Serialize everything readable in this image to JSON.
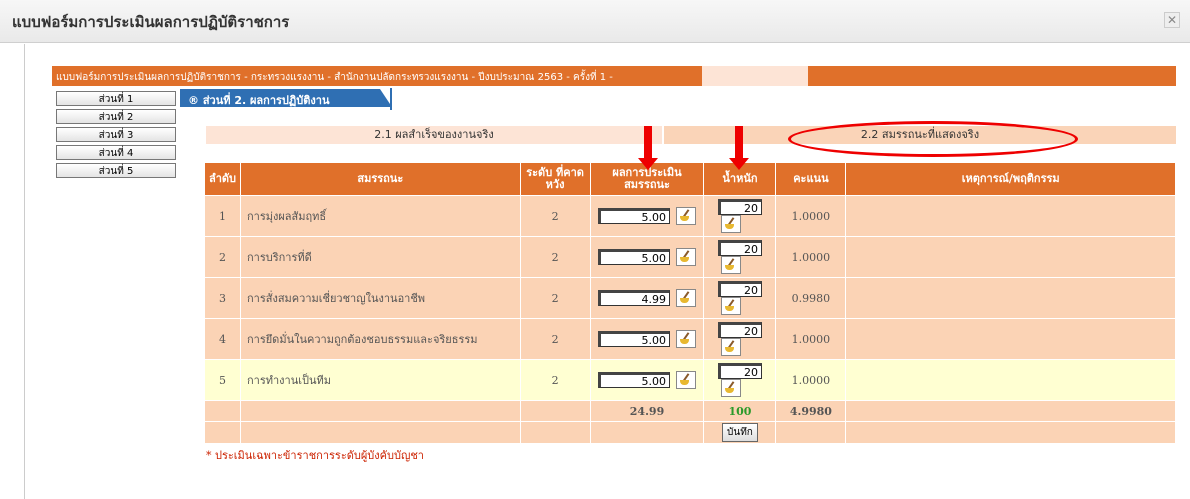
{
  "modal": {
    "title": "แบบฟอร์มการประเมินผลการปฏิบัติราชการ",
    "close_icon": "close-icon"
  },
  "header_bar": {
    "text": "แบบฟอร์มการประเมินผลการปฏิบัติราชการ - กระทรวงแรงงาน - สำนักงานปลัดกระทรวงแรงงาน - ปีงบประมาณ 2563 - ครั้งที่ 1 -"
  },
  "sidebar": {
    "items": [
      "ส่วนที่ 1",
      "ส่วนที่ 2",
      "ส่วนที่ 3",
      "ส่วนที่ 4",
      "ส่วนที่ 5"
    ]
  },
  "section_tab": {
    "label": "® ส่วนที่ 2. ผลการปฏิบัติงาน"
  },
  "subtabs": {
    "a": "2.1 ผลสำเร็จของงานจริง",
    "b": "2.2 สมรรถนะที่แสดงจริง"
  },
  "table": {
    "headers": {
      "no": "ลำดับ",
      "competency": "สมรรถนะ",
      "expected": "ระดับ ที่คาดหวัง",
      "score": "ผลการประเมิน สมรรถนะ",
      "weight": "น้ำหนัก",
      "points": "คะแนน",
      "event": "เหตุการณ์/พฤติกรรม"
    },
    "rows": [
      {
        "no": "1",
        "name": "การมุ่งผลสัมฤทธิ์",
        "expected": "2",
        "score": "5.00",
        "weight": "20",
        "points": "1.0000"
      },
      {
        "no": "2",
        "name": "การบริการที่ดี",
        "expected": "2",
        "score": "5.00",
        "weight": "20",
        "points": "1.0000"
      },
      {
        "no": "3",
        "name": "การสั่งสมความเชี่ยวชาญในงานอาชีพ",
        "expected": "2",
        "score": "4.99",
        "weight": "20",
        "points": "0.9980"
      },
      {
        "no": "4",
        "name": "การยึดมั่นในความถูกต้องชอบธรรมและจริยธรรม",
        "expected": "2",
        "score": "5.00",
        "weight": "20",
        "points": "1.0000"
      },
      {
        "no": "5",
        "name": "การทำงานเป็นทีม",
        "expected": "2",
        "score": "5.00",
        "weight": "20",
        "points": "1.0000"
      }
    ],
    "totals": {
      "score": "24.99",
      "weight": "100",
      "points": "4.9980"
    },
    "save_label": "บันทึก"
  },
  "footnote": "* ประเมินเฉพาะข้าราชการระดับผู้บังคับบัญชา",
  "colors": {
    "accent": "#e0702a",
    "tab_blue": "#2f6fb3",
    "annotation_red": "#ee0000"
  }
}
